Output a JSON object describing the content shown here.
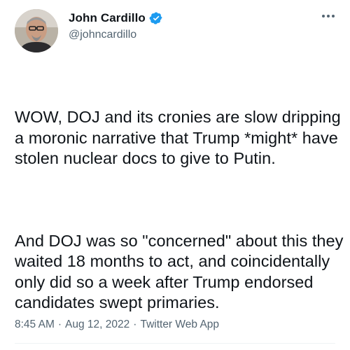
{
  "author": {
    "display_name": "John Cardillo",
    "handle": "@johncardillo",
    "verified": true,
    "verified_color": "#1d9bf0",
    "avatar_icon": "profile-photo"
  },
  "tweet": {
    "paragraphs": [
      "WOW, DOJ and its cronies are slow dripping a moronic narrative that Trump *might* have stolen nuclear docs to give to Putin.",
      "And DOJ was so \"concerned\" about this they waited 18 months to act, and coincidentally only did so a week after Trump endorsed candidates swept primaries."
    ]
  },
  "meta": {
    "time": "8:45 AM",
    "separator": "·",
    "date": "Aug 12, 2022",
    "source": "Twitter Web App"
  },
  "icons": {
    "more": "more-horizontal-icon",
    "verified": "verified-badge-icon"
  }
}
